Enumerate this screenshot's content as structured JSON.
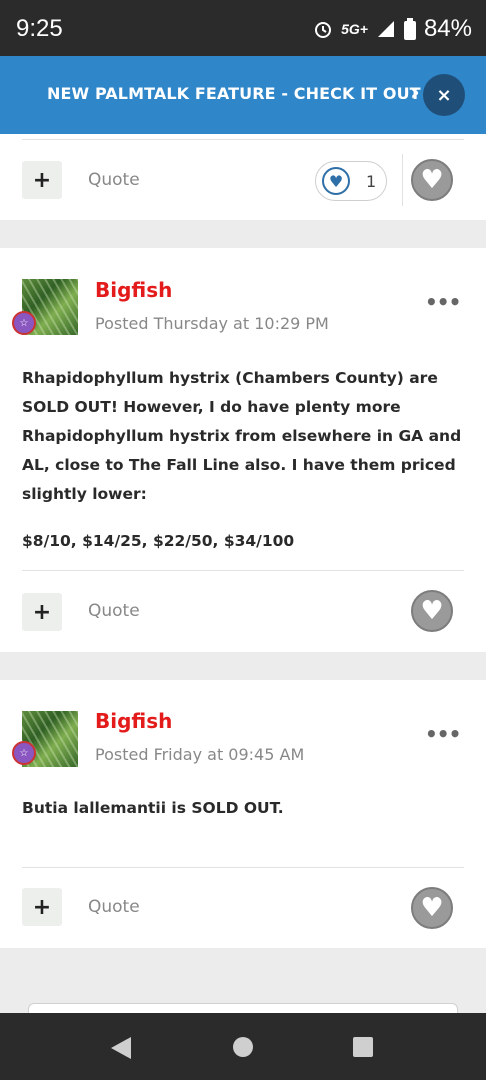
{
  "status_bar": {
    "time": "9:25",
    "network": "5G+",
    "battery": "84%",
    "icons": [
      "alarm-icon",
      "signal-icon",
      "battery-icon"
    ]
  },
  "banner": {
    "text": "NEW PALMTALK FEATURE - CHECK IT OUT",
    "chevron": "›",
    "close": "×"
  },
  "top_card": {
    "quote_label": "Quote",
    "reaction_count": "1"
  },
  "posts": [
    {
      "author": "Bigfish",
      "posted": "Posted Thursday at 10:29 PM",
      "body": [
        "Rhapidophyllum hystrix (Chambers County) are SOLD OUT!  However, I do have plenty more Rhapidophyllum hystrix from elsewhere in GA and AL, close to The Fall Line also.  I have them priced slightly lower:",
        "$8/10, $14/25, $22/50, $34/100"
      ],
      "quote_label": "Quote"
    },
    {
      "author": "Bigfish",
      "posted": "Posted Friday at 09:45 AM",
      "body": [
        "Butia lallemantii is SOLD OUT."
      ],
      "quote_label": "Quote"
    }
  ],
  "colors": {
    "banner": "#2f86c8",
    "author": "#e41b1b",
    "statusbar": "#2b2b2b"
  }
}
